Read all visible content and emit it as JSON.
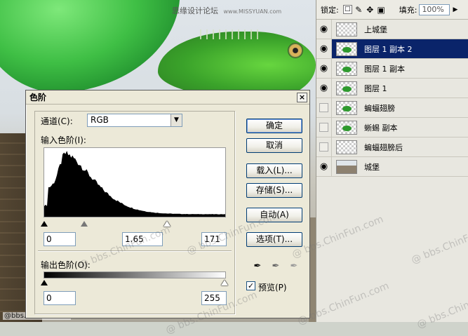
{
  "background": {
    "watermark_cn": "思缘设计论坛",
    "watermark_url": "www.MISSYUAN.com",
    "bottom_mark": "@bbs.chinfun.com",
    "overlay_marks": [
      "@ bbs.ChinFun.com",
      "@ bbs.ChinFun.com",
      "@ bbs.ChinFun.com",
      "@ bbs.ChinFun.com",
      "@ bbs.ChinFun.com",
      "@ bbs.ChinFun.com",
      "@ bbs.ChinFun.com"
    ]
  },
  "layers_panel": {
    "lock_label": "锁定:",
    "fill_label": "填充:",
    "fill_value": "100%",
    "layers": [
      {
        "name": "上城堡",
        "visible": true,
        "selected": false,
        "thumb": "empty"
      },
      {
        "name": "图层 1 副本 2",
        "visible": true,
        "selected": true,
        "thumb": "green"
      },
      {
        "name": "图层 1 副本",
        "visible": true,
        "selected": false,
        "thumb": "green"
      },
      {
        "name": "图层 1",
        "visible": true,
        "selected": false,
        "thumb": "green"
      },
      {
        "name": "蝙蝠翅膀",
        "visible": false,
        "selected": false,
        "thumb": "green"
      },
      {
        "name": "蜥蜴 副本",
        "visible": false,
        "selected": false,
        "thumb": "green"
      },
      {
        "name": "蝙蝠翅膀后",
        "visible": false,
        "selected": false,
        "thumb": "empty"
      },
      {
        "name": "城堡",
        "visible": true,
        "selected": false,
        "thumb": "castle"
      }
    ]
  },
  "levels_dialog": {
    "title": "色阶",
    "channel_label": "通道(C):",
    "channel_value": "RGB",
    "input_levels_label": "输入色阶(I):",
    "input_black": "0",
    "input_gamma": "1.65",
    "input_white": "171",
    "output_levels_label": "输出色阶(O):",
    "output_black": "0",
    "output_white": "255",
    "buttons": {
      "ok": "确定",
      "cancel": "取消",
      "load": "载入(L)...",
      "save": "存储(S)...",
      "auto": "自动(A)",
      "options": "选项(T)..."
    },
    "preview_label": "预览(P)",
    "preview_checked": true
  }
}
